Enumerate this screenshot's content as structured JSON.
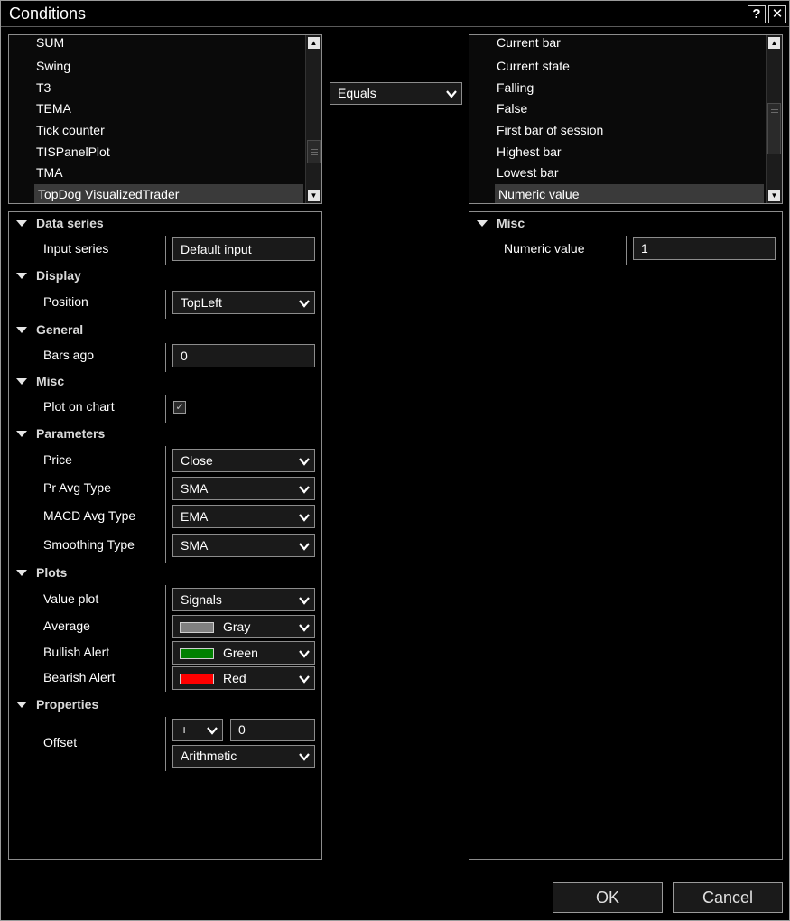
{
  "window": {
    "title": "Conditions",
    "help_label": "?",
    "close_label": "✕"
  },
  "indicator_list": {
    "items": [
      "SUM",
      "Swing",
      "T3",
      "TEMA",
      "Tick counter",
      "TISPanelPlot",
      "TMA",
      "TopDog VisualizedTrader"
    ],
    "selected": "TopDog VisualizedTrader"
  },
  "operator": {
    "selected": "Equals"
  },
  "value_list": {
    "items": [
      "Current bar",
      "Current state",
      "Falling",
      "False",
      "First bar of session",
      "Highest bar",
      "Lowest bar",
      "Numeric value"
    ],
    "selected": "Numeric value"
  },
  "left_props": {
    "data_series": {
      "label": "Data series",
      "input_series_label": "Input series",
      "input_series_value": "Default input"
    },
    "display": {
      "label": "Display",
      "position_label": "Position",
      "position_value": "TopLeft"
    },
    "general": {
      "label": "General",
      "bars_ago_label": "Bars ago",
      "bars_ago_value": "0"
    },
    "misc": {
      "label": "Misc",
      "plot_on_chart_label": "Plot on chart",
      "plot_on_chart_checked": true
    },
    "parameters": {
      "label": "Parameters",
      "price_label": "Price",
      "price_value": "Close",
      "pr_avg_type_label": "Pr Avg Type",
      "pr_avg_type_value": "SMA",
      "macd_avg_type_label": "MACD Avg Type",
      "macd_avg_type_value": "EMA",
      "smoothing_type_label": "Smoothing Type",
      "smoothing_type_value": "SMA"
    },
    "plots": {
      "label": "Plots",
      "value_plot_label": "Value plot",
      "value_plot_value": "Signals",
      "average_label": "Average",
      "average_value": "Gray",
      "average_color": "#808080",
      "bullish_label": "Bullish Alert",
      "bullish_value": "Green",
      "bullish_color": "#008000",
      "bearish_label": "Bearish Alert",
      "bearish_value": "Red",
      "bearish_color": "#ff0000"
    },
    "properties": {
      "label": "Properties",
      "offset_label": "Offset",
      "offset_sign": "+",
      "offset_value": "0",
      "offset_type": "Arithmetic"
    }
  },
  "right_props": {
    "misc": {
      "label": "Misc",
      "numeric_value_label": "Numeric value",
      "numeric_value": "1"
    }
  },
  "buttons": {
    "ok": "OK",
    "cancel": "Cancel"
  }
}
